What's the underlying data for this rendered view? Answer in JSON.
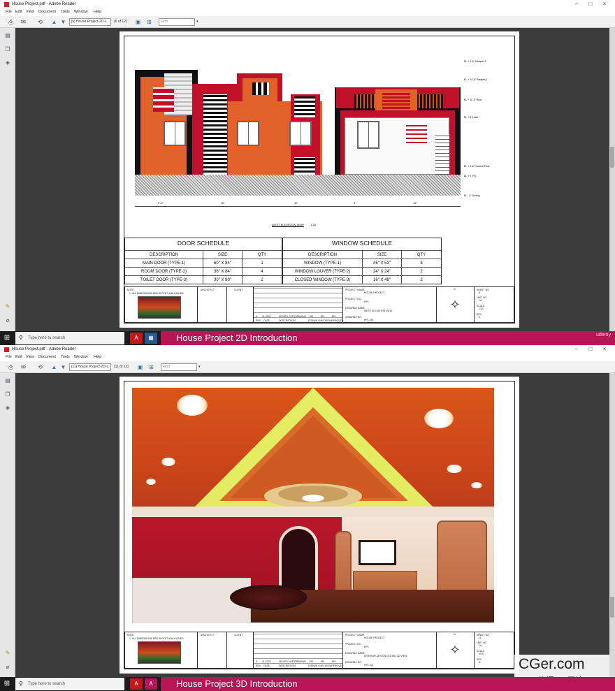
{
  "window_title": "House Project.pdf - Adobe Reader",
  "menu": [
    "File",
    "Edit",
    "View",
    "Document",
    "Tools",
    "Window",
    "Help"
  ],
  "pane1": {
    "page_field": "[6] House Project-2D-L",
    "page_count": "(6 of 12)",
    "find_placeholder": "Find",
    "elevation_title": "WEST ELEVATION VIEW",
    "elevation_scale": "1:30",
    "level_labels": [
      "EL + 1'-6\" Parapet-2",
      "EL + 14'-6\" Parapet-1",
      "EL + 11'-6\" Roof",
      "EL + 8' Lintel",
      "EL + 1'-6\" Ground Floor",
      "EL + 0' FFL",
      "EL - 3' Footing"
    ],
    "dimensions": [
      "7'-0\"",
      "10'",
      "12'",
      "8'",
      "12'"
    ],
    "door_schedule": {
      "title": "DOOR SCHEDULE",
      "headers": [
        "DESCRIPTION",
        "SIZE",
        "QTY"
      ],
      "rows": [
        [
          "MAIN DOOR (TYPE-1)",
          "60\" X 84\"",
          "1"
        ],
        [
          "ROOM DOOR (TYPE-2)",
          "36\" X 84\"",
          "4"
        ],
        [
          "TOILET DOOR (TYPE-3)",
          "30\" X 80\"",
          "2"
        ]
      ]
    },
    "window_schedule": {
      "title": "WINDOW SCHEDULE",
      "headers": [
        "DESCRIPTION",
        "SIZE",
        "QTY"
      ],
      "rows": [
        [
          "WINDOW (TYPE-1)",
          "46\" X 53\"",
          "8"
        ],
        [
          "WINDOW LOUVER (TYPE-2)",
          "24\" X 24\"",
          "2"
        ],
        [
          "CLOSED WINDOW (TYPE-3)",
          "16\" X 48\"",
          "3"
        ]
      ]
    },
    "title_block": {
      "note_label": "NOTE",
      "note_text": "1. ALL DIMENSIONS ARE IN FEET AND INCHES",
      "architect": "ARCHITECT",
      "client": "CLIENT",
      "project_name_label": "PROJECT NAME",
      "project_name": "HOUSE PROJECT",
      "project_no_label": "PROJECT NO",
      "project_no": "HP1",
      "drawing_name_label": "DRAWING NAME",
      "drawing_name": "WEST ELEVATION VIEW",
      "drawing_no_label": "DRAWING NO",
      "drawing_no": "HP1-001",
      "sheet_no_label": "SHEET NO",
      "sheet_no": "6",
      "unit_no_label": "UNIT NO",
      "unit_no": "1A",
      "scale_label": "SCALE",
      "scale": "1:30",
      "rev_label": "REV",
      "rev": "A",
      "rev_row": [
        "A",
        "11-2022",
        "ISSUED FOR DRAWING",
        "RR",
        "RR",
        "RR"
      ],
      "rev_headers": [
        "REV",
        "DATE",
        "DESCRIPTION",
        "DRAWN",
        "CHECKED",
        "APPROVED"
      ]
    },
    "taskbar": {
      "search": "Type here to search",
      "banner": "House Project 2D Introduction",
      "udemy": "udemy"
    }
  },
  "pane2": {
    "page_field": "[11] House Project-2D-L",
    "page_count": "(11 of 12)",
    "find_placeholder": "Find",
    "title_block": {
      "note_label": "NOTE",
      "note_text": "1. ALL DIMENSIONS ARE IN FEET AND INCHES",
      "architect": "ARCHITECT",
      "client": "CLIENT",
      "project_name_label": "PROJECT NAME",
      "project_name": "HOUSE PROJECT",
      "project_no_label": "PROJECT NO",
      "project_no": "HP1",
      "drawing_name_label": "DRAWING NAME",
      "drawing_name": "INTERIOR DESIGN CEILING 3D VIEW",
      "drawing_no_label": "DRAWING NO",
      "drawing_no": "HP1-021",
      "sheet_no_label": "SHEET NO",
      "sheet_no": "11",
      "unit_no_label": "UNIT NO",
      "unit_no": "1A",
      "scale_label": "SCALE",
      "scale": "NTS",
      "rev_label": "REV",
      "rev": "A",
      "rev_row": [
        "A",
        "11-2022",
        "ISSUED FOR DRAWING",
        "RR",
        "RR",
        "RR"
      ],
      "rev_headers": [
        "REV",
        "DATE",
        "DESCRIPTION",
        "DRAWN",
        "CHECKED",
        "APPROVED"
      ]
    },
    "taskbar": {
      "search": "Type here to search",
      "banner": "House Project 3D Introduction"
    },
    "watermark": {
      "brand": "CGer.com",
      "sub": "CG资源 CG网站"
    }
  },
  "colors": {
    "accent_banner": "#b71553",
    "facade_orange": "#e0622a",
    "facade_red": "#c0102a",
    "ceiling_orange": "#d9561a",
    "cove_green": "#d8ff5a"
  },
  "icons": {
    "toolbar": [
      "print-icon",
      "share-icon",
      "page-up-icon",
      "page-down-icon",
      "fit-page-icon",
      "fit-width-icon"
    ],
    "nav": [
      "pages-icon",
      "bookmarks-icon",
      "layers-icon",
      "signature-icon",
      "attachment-icon"
    ]
  }
}
